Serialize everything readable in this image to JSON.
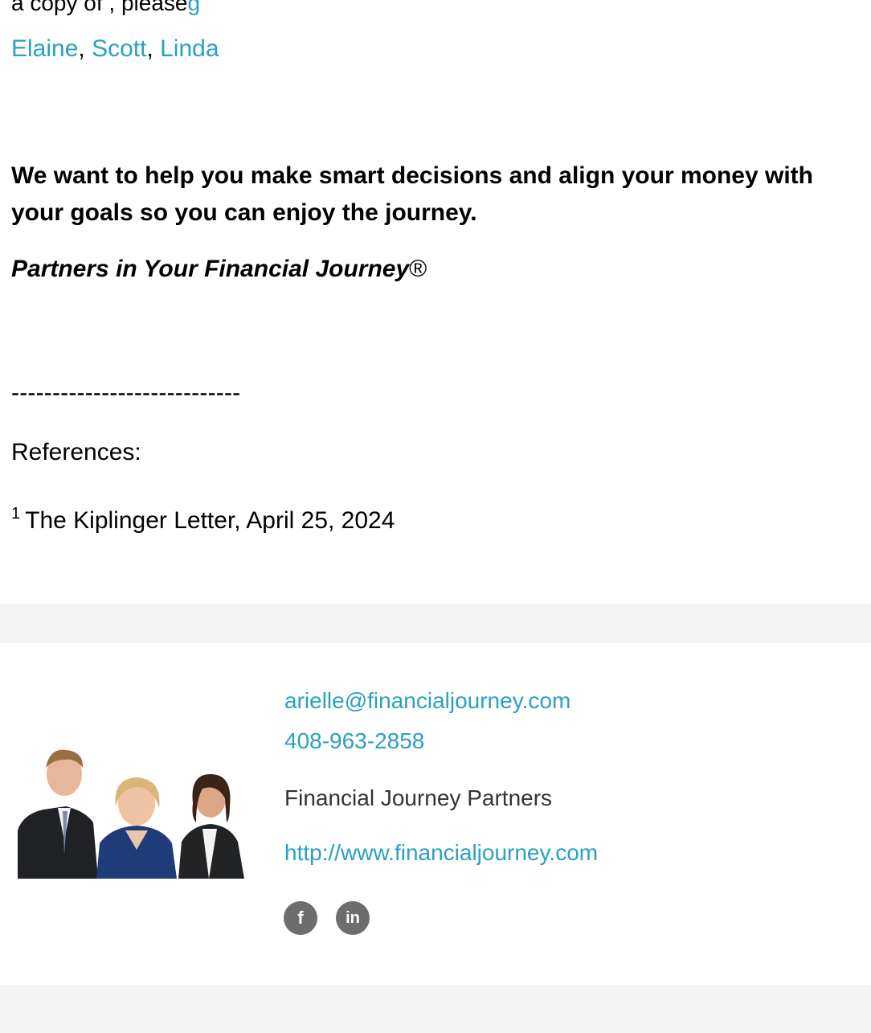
{
  "top_partial": {
    "text": "a copy of , please",
    "link": "g"
  },
  "signers": [
    "Elaine",
    "Scott",
    "Linda"
  ],
  "signer_separator": ", ",
  "mission": "We want to help you make smart decisions and align your money with your goals so you can enjoy the journey.",
  "tagline": {
    "text": "Partners in Your Financial Journey",
    "mark": "®"
  },
  "divider": "----------------------------",
  "references": {
    "label": "References:",
    "items": [
      {
        "num": "1",
        "text": "The Kiplinger Letter, April 25, 2024"
      }
    ]
  },
  "footer": {
    "email": "arielle@financialjourney.com",
    "phone": "408-963-2858",
    "company": "Financial Journey Partners",
    "website": "http://www.financialjourney.com",
    "social": [
      {
        "icon": "facebook-icon",
        "glyph": "f"
      },
      {
        "icon": "linkedin-icon",
        "glyph": "in"
      }
    ]
  },
  "colors": {
    "link": "#2aa0c2",
    "band": "#f4f4f4",
    "social_bg": "#6d6d6d"
  }
}
